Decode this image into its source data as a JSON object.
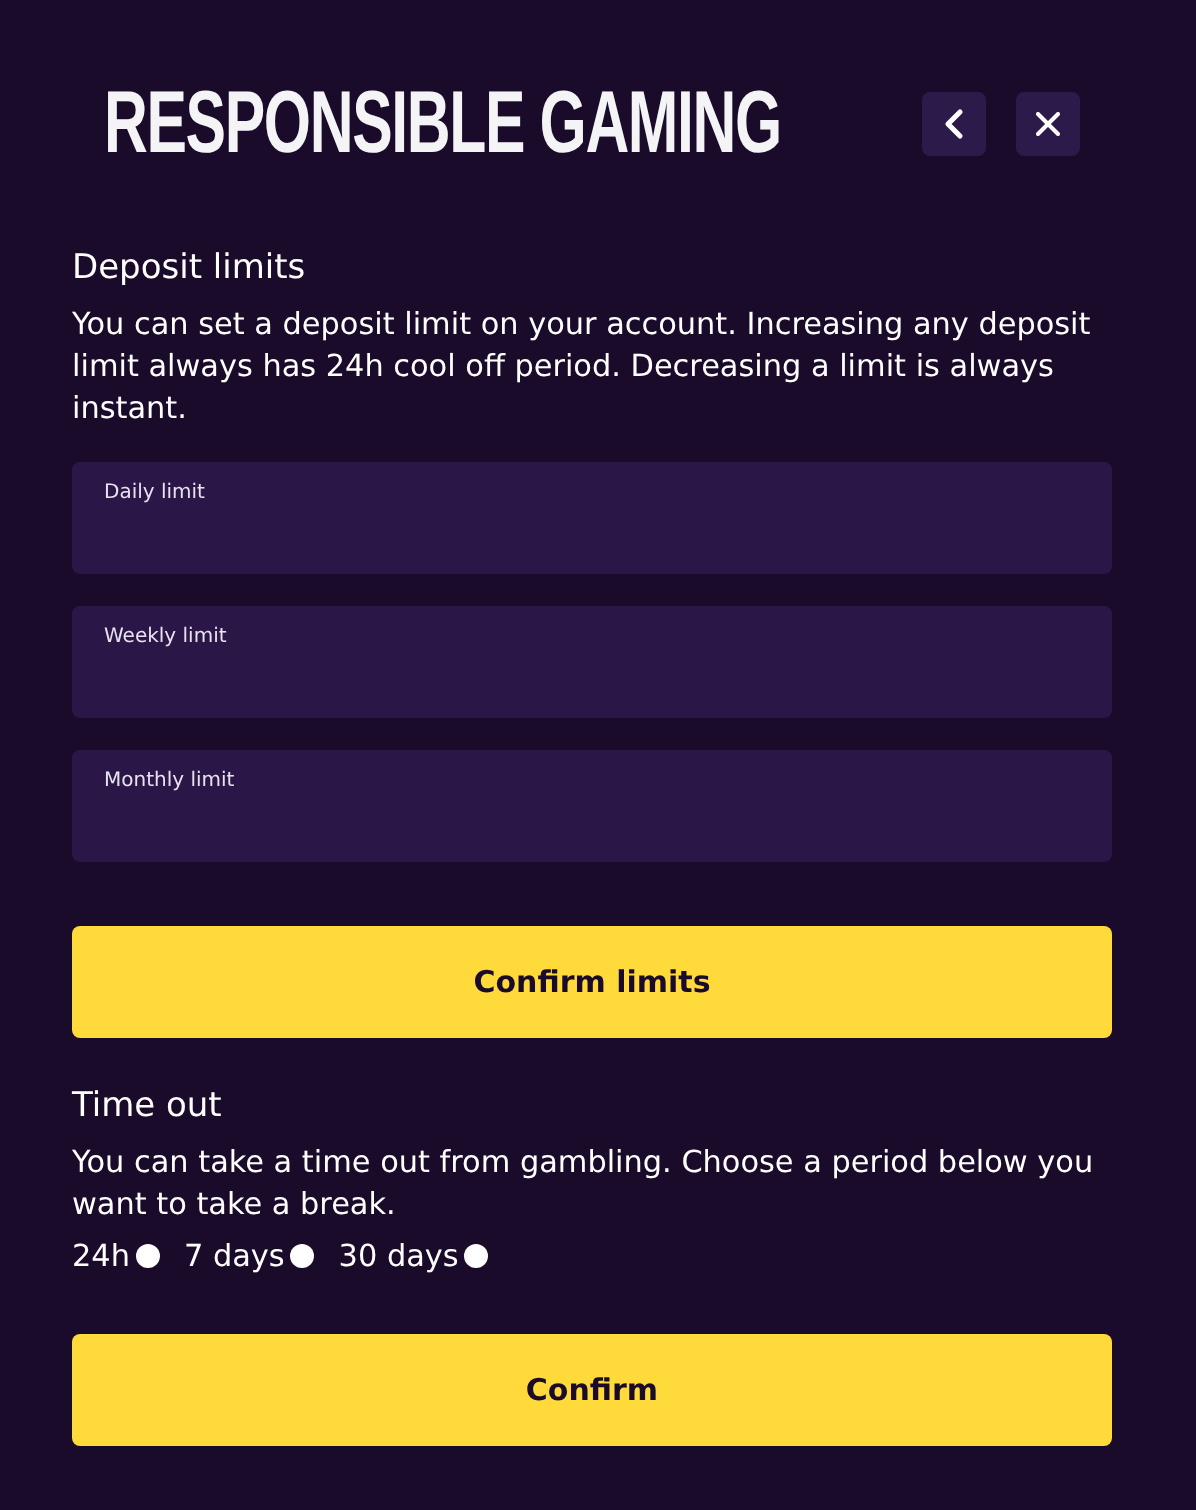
{
  "header": {
    "title": "RESPONSIBLE GAMING",
    "buttons": [
      {
        "kind": "back"
      },
      {
        "kind": "close"
      }
    ]
  },
  "deposit_limits": {
    "heading": "Deposit limits",
    "description": "You can set a deposit limit on your account. Increasing any deposit limit always has 24h cool off period. Decreasing a limit is always instant.",
    "fields": [
      {
        "label": "Daily limit"
      },
      {
        "label": "Weekly limit"
      },
      {
        "label": "Monthly limit"
      }
    ],
    "button": "Confirm limits"
  },
  "time_out": {
    "heading": "Time out",
    "description": "You can take a time out from gambling. Choose a period below you want to take a break.",
    "options": [
      {
        "label": "24h",
        "selected": false
      },
      {
        "label": "7 days",
        "selected": false
      },
      {
        "label": "30 days",
        "selected": false
      }
    ],
    "button": "Confirm"
  }
}
